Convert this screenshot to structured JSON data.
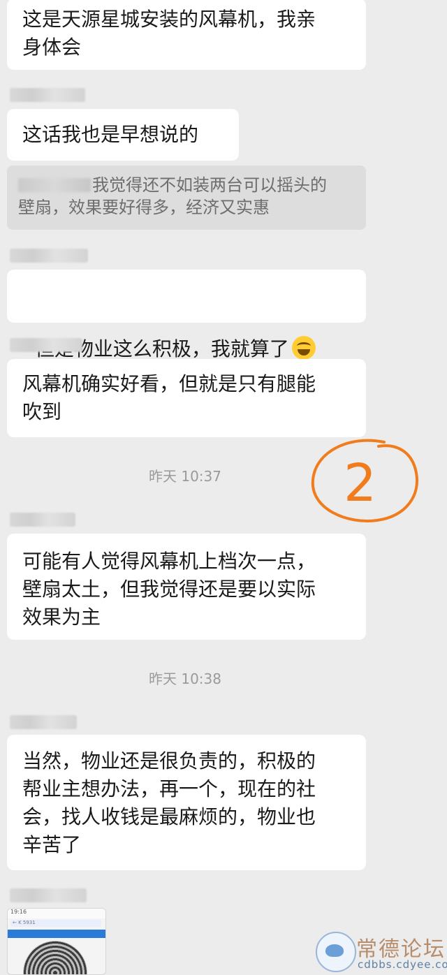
{
  "messages": [
    {
      "text": "这是天源星城安装的风幕机，我亲\n身体会"
    },
    {
      "text": "这话我也是早想说的"
    },
    {
      "quote": "我觉得还不如装两台可以摇头的\n壁扇，效果要好得多，经济又实惠"
    },
    {
      "text": "但是物业这么积极，我就算了"
    },
    {
      "text": "风幕机确实好看，但就是只有腿能\n吹到"
    },
    {
      "text": "可能有人觉得风幕机上档次一点，\n壁扇太土，但我觉得还是要以实际\n效果为主"
    },
    {
      "text": "当然，物业还是很负责的，积极的\n帮业主想办法，再一个，现在的社\n会，找人收钱是最麻烦的，物业也\n辛苦了"
    }
  ],
  "timestamps": [
    "昨天 10:37",
    "昨天 10:38"
  ],
  "annotation": {
    "label": "2",
    "color": "#f07c1e"
  },
  "emoji": "laughing-tears-emoji",
  "thumbnail": {
    "top_bar": "19:16",
    "nav": "← K 5931"
  },
  "watermark": {
    "title": "常德论坛",
    "url": "cdbbs.cdyee.com"
  }
}
